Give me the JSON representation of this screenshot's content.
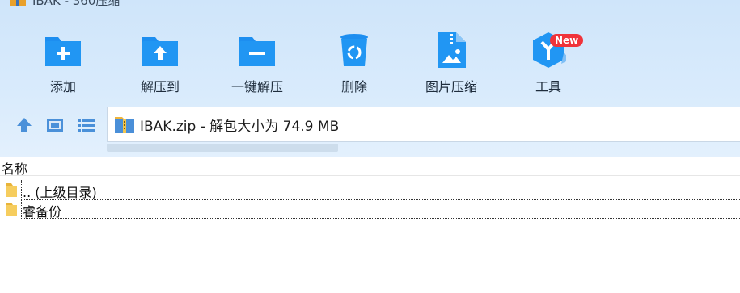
{
  "window": {
    "title": "IBAK - 360压缩"
  },
  "toolbar": {
    "add": "添加",
    "extract_to": "解压到",
    "one_click_extract": "一键解压",
    "delete": "删除",
    "image_compress": "图片压缩",
    "tools": "工具",
    "tools_badge": "New"
  },
  "nav": {
    "path_text": "IBAK.zip - 解包大小为 74.9 MB"
  },
  "file_list": {
    "column_name": "名称",
    "rows": [
      {
        "name": ".. (上级目录)"
      },
      {
        "name": "睿备份"
      }
    ]
  },
  "colors": {
    "toolbar_bg": "#d9ebfc",
    "icon_blue": "#1d8ef0",
    "badge_red": "#f0333a",
    "folder_yellow": "#f4c54a"
  }
}
